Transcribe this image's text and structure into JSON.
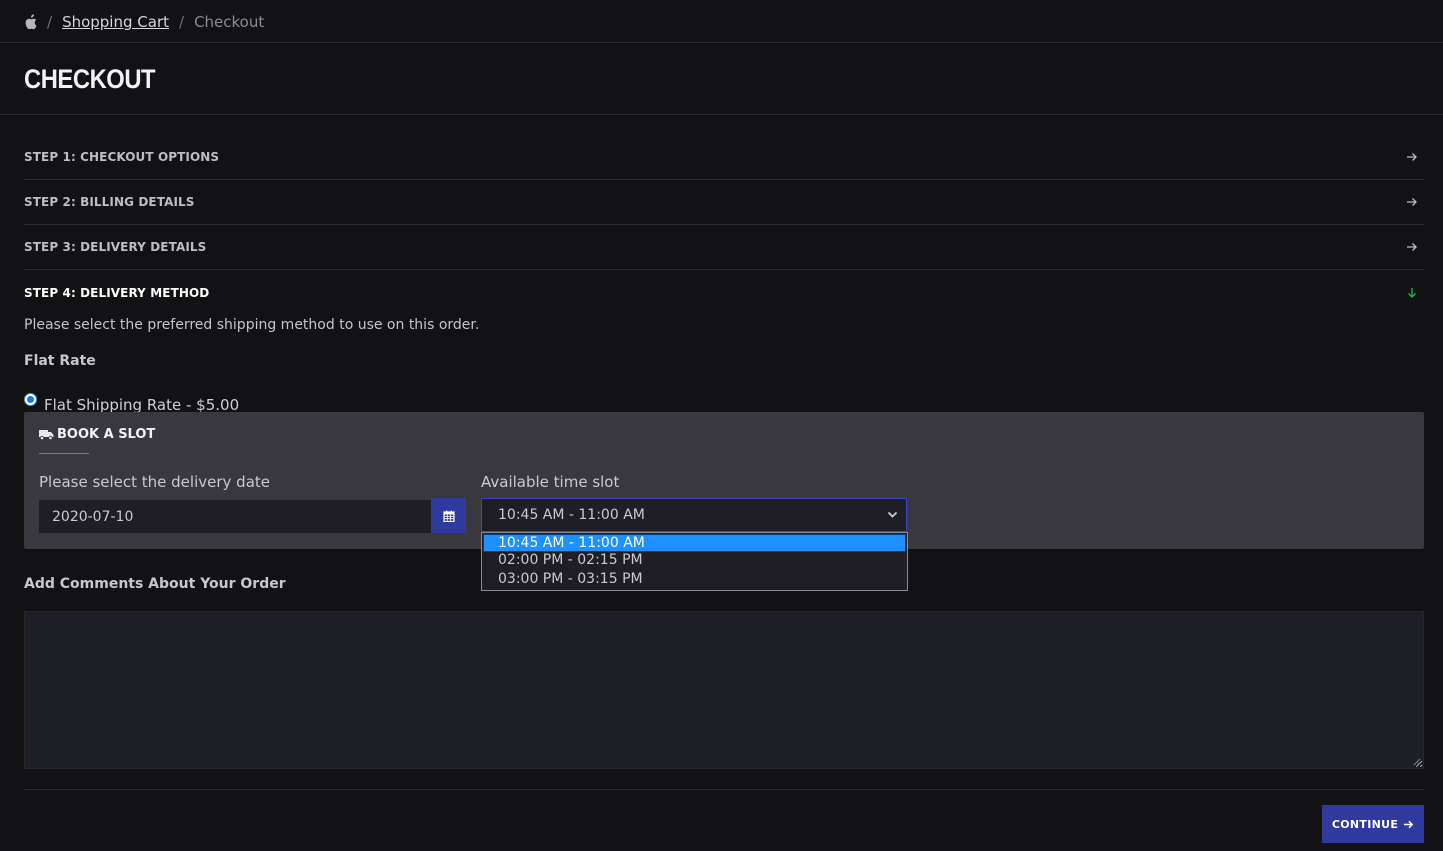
{
  "breadcrumb": {
    "home_icon": "apple-icon",
    "separator": "/",
    "items": [
      "Shopping Cart",
      "Checkout"
    ]
  },
  "page_title": "CHECKOUT",
  "steps": [
    {
      "label": "STEP 1: CHECKOUT OPTIONS",
      "icon": "arrow-right-icon",
      "active": false
    },
    {
      "label": "STEP 2: BILLING DETAILS",
      "icon": "arrow-right-icon",
      "active": false
    },
    {
      "label": "STEP 3: DELIVERY DETAILS",
      "icon": "arrow-right-icon",
      "active": false
    },
    {
      "label": "STEP 4: DELIVERY METHOD",
      "icon": "arrow-down-icon",
      "active": true
    }
  ],
  "delivery_method": {
    "instructions": "Please select the preferred shipping method to use on this order.",
    "method_title": "Flat Rate",
    "option_label": "Flat Shipping Rate - $5.00",
    "option_selected": true
  },
  "book_slot": {
    "heading": "BOOK A SLOT",
    "heading_icon": "truck-icon",
    "date_label": "Please select the delivery date",
    "date_value": "2020-07-10",
    "calendar_icon": "calendar-icon",
    "slot_label": "Available time slot",
    "selected_slot": "10:45 AM - 11:00 AM",
    "slot_options": [
      "10:45 AM - 11:00 AM",
      "02:00 PM - 02:15 PM",
      "03:00 PM - 03:15 PM"
    ]
  },
  "comments": {
    "label": "Add Comments About Your Order",
    "value": ""
  },
  "continue_button": {
    "label": "CONTINUE",
    "icon": "arrow-right-icon"
  },
  "colors": {
    "background": "#121214",
    "panel": "#38383e",
    "accent_button": "#2f3a9e",
    "active_arrow": "#1db954",
    "selected_option": "#1e90ff"
  }
}
